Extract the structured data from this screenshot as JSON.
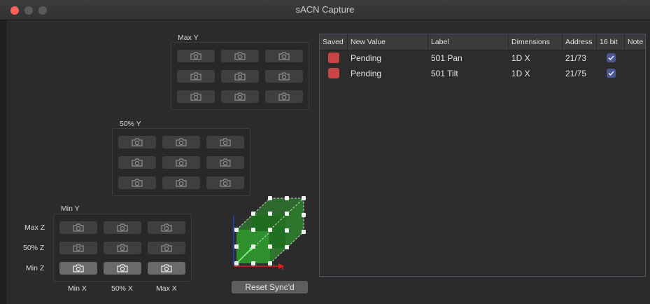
{
  "window": {
    "title": "sACN Capture"
  },
  "groups": {
    "max_y": {
      "label": "Max Y"
    },
    "mid_y": {
      "label": "50% Y"
    },
    "min_y": {
      "label": "Min Y"
    }
  },
  "axis_labels": {
    "rows": [
      "Max Z",
      "50% Z",
      "Min Z"
    ],
    "cols": [
      "Min X",
      "50% X",
      "Max X"
    ]
  },
  "reset_button": {
    "label": "Reset Sync'd"
  },
  "table": {
    "columns": [
      "Saved",
      "New Value",
      "Label",
      "Dimensions",
      "Address",
      "16 bit",
      "Note"
    ],
    "rows": [
      {
        "saved": false,
        "new_value": "Pending",
        "label": "501 Pan",
        "dimensions": "1D X",
        "address": "21/73",
        "sixteen_bit": true
      },
      {
        "saved": false,
        "new_value": "Pending",
        "label": "501 Tilt",
        "dimensions": "1D X",
        "address": "21/75",
        "sixteen_bit": true
      }
    ]
  },
  "colors": {
    "saved_indicator": "#c94444",
    "checkbox": "#4a5790",
    "cube_green": "#2fa32f",
    "axis_x": "#e02020",
    "axis_y": "#2a3fd0"
  },
  "icons": {
    "capture_button": "camera-icon",
    "checkbox": "checkmark-icon"
  }
}
